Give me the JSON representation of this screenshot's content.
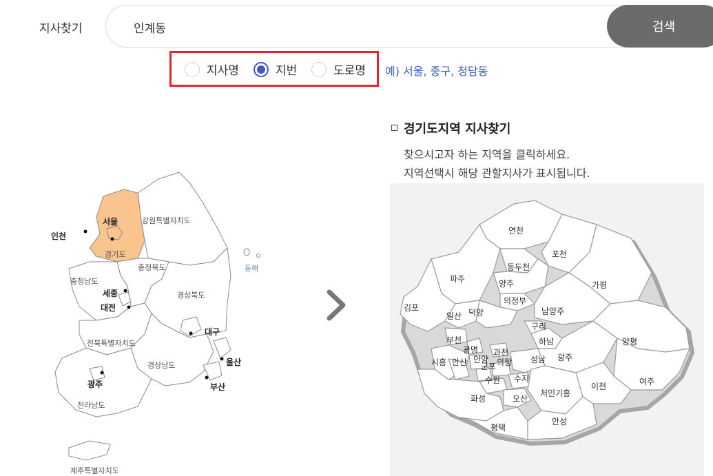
{
  "search": {
    "label": "지사찾기",
    "value": "인계동",
    "button_label": "검색"
  },
  "search_types": [
    {
      "label": "지사명",
      "selected": false
    },
    {
      "label": "지번",
      "selected": true
    },
    {
      "label": "도로명",
      "selected": false
    }
  ],
  "example_text": "예) 서울, 중구, 청담동",
  "korea_map": {
    "highlight_color": "#f9c48e",
    "regions": {
      "seoul": "서울",
      "gangwon": "강원특별자치도",
      "incheon": "인천",
      "gyeonggi": "경기도",
      "chungbuk": "충청북도",
      "chungnam": "충청남도",
      "sejong": "세종",
      "daejeon": "대전",
      "gyeongbuk": "경상북도",
      "daegu": "대구",
      "jeonbuk": "전북특별자치도",
      "gyeongnam": "경상남도",
      "ulsan": "울산",
      "busan": "부산",
      "gwangju": "광주",
      "jeonnam": "전라남도",
      "jeju": "제주특별자치도",
      "donghae": "동해"
    }
  },
  "gyeonggi_section": {
    "title": "경기도지역 지사찾기",
    "desc1": "찾으시고자 하는 지역을 클릭하세요.",
    "desc2": "지역선택시 해당 관할지사가 표시됩니다.",
    "regions": {
      "yeoncheon": "연천",
      "pocheon": "포천",
      "dongducheon": "동두천",
      "paju": "파주",
      "yangju": "양주",
      "gapyeong": "가평",
      "uijeongbu": "의정부",
      "gimpo": "김포",
      "ilsan": "일산",
      "deogyang": "덕양",
      "namyangju": "남양주",
      "guri": "구리",
      "bucheon": "부천",
      "hanam": "하남",
      "yangpyeong": "양평",
      "gwangmyeong": "광명",
      "gwacheon": "과천",
      "siheung": "시흥",
      "ansan": "안산",
      "anyang": "안양",
      "gunpo": "군포",
      "uiwang": "의왕",
      "seongnam": "성남",
      "gwangju": "광주",
      "suwon": "수원",
      "suji": "수지",
      "yeoju": "여주",
      "hwaseong": "화성",
      "osan": "오산",
      "cheoingiheung": "처인기흥",
      "icheon": "이천",
      "anseong": "안성",
      "pyeongtaek": "평택"
    }
  }
}
